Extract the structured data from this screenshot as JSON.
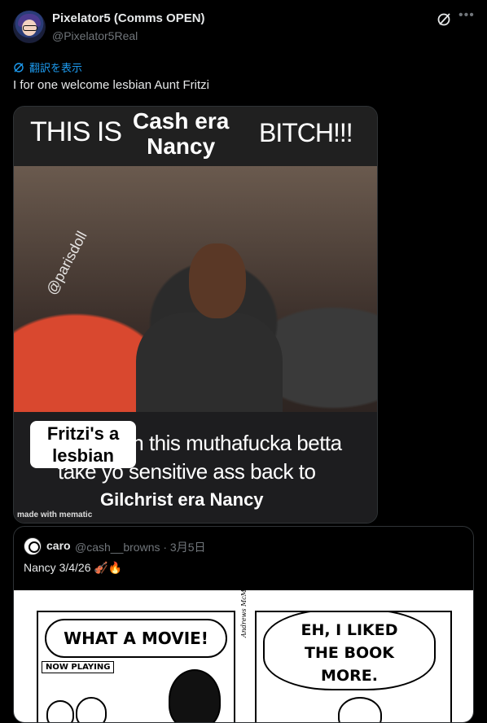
{
  "post": {
    "display_name": "Pixelator5 (Comms OPEN)",
    "handle": "@Pixelator5Real",
    "translate_label": "翻訳を表示",
    "text": "I for one welcome lesbian Aunt Fritzi",
    "more_icon": "more-icon",
    "grok_icon": "grok-icon"
  },
  "meme": {
    "top_left": "THIS IS",
    "top_center_line1": "Cash era",
    "top_center_line2": "Nancy",
    "top_right": "BITCH!!!",
    "sticker_line1": "Fritzi's a",
    "sticker_line2": "lesbian",
    "line1": "in this muthafucka betta",
    "line2": "take yo sensitive ass back to",
    "line3": "Gilchrist era Nancy",
    "watermark": "@parisdoll",
    "footer": "made with mematic"
  },
  "quote": {
    "display_name": "caro",
    "handle_date": "@cash__browns · 3月5日",
    "text": "Nancy 3/4/26 🎻🔥",
    "comic": {
      "panel1_bubble": "WHAT A MOVIE!",
      "panel1_sign": "NOW PLAYING",
      "panel2_bubble_line1": "EH, I LIKED",
      "panel2_bubble_line2": "THE BOOK",
      "panel2_bubble_line3": "MORE.",
      "credit": "Andrews McMeel"
    }
  }
}
